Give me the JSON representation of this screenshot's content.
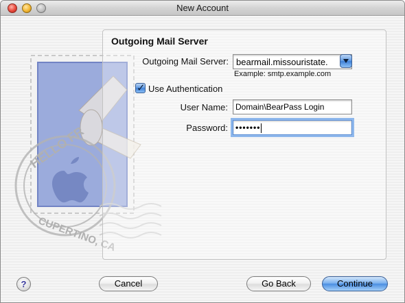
{
  "window": {
    "title": "New Account"
  },
  "section": {
    "title": "Outgoing Mail Server"
  },
  "server": {
    "label": "Outgoing Mail Server:",
    "value": "bearmail.missouristate.",
    "example": "Example: smtp.example.com"
  },
  "auth": {
    "label": "Use Authentication",
    "checked": true
  },
  "username": {
    "label": "User Name:",
    "value": "Domain\\BearPass Login"
  },
  "password": {
    "label": "Password:",
    "value": "•••••••"
  },
  "stamp": {
    "text_top": "HELLO FR",
    "text_bottom": "CUPERTINO, CA"
  },
  "buttons": {
    "help": "?",
    "cancel": "Cancel",
    "back": "Go Back",
    "continue": "Continue"
  },
  "colors": {
    "accent": "#4c8fe2",
    "stamp_blue": "#8c9fd8"
  }
}
